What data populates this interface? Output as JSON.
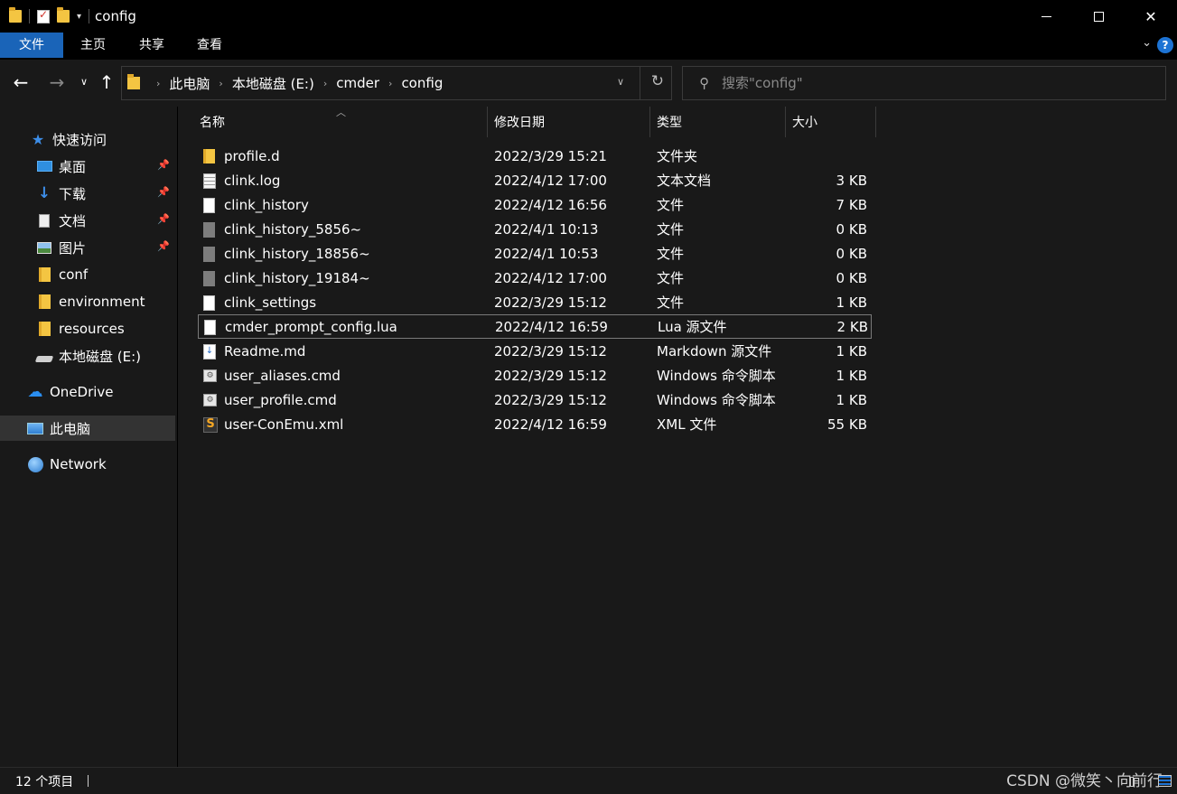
{
  "window": {
    "title": "config",
    "controls": {
      "minimize": "—",
      "maximize": "□",
      "close": "✕"
    }
  },
  "ribbon": {
    "tabs": [
      "文件",
      "主页",
      "共享",
      "查看"
    ],
    "expand_icon": "chevron-down-icon",
    "help_label": "?"
  },
  "nav": {
    "back": "←",
    "forward": "→",
    "recent": "⌄",
    "up": "↑",
    "breadcrumb": [
      "此电脑",
      "本地磁盘 (E:)",
      "cmder",
      "config"
    ],
    "refresh": "↻",
    "search_placeholder": "搜索\"config\""
  },
  "sidebar": {
    "items": [
      {
        "label": "快速访问",
        "icon": "star-icon",
        "pinned": false
      },
      {
        "label": "桌面",
        "icon": "desktop-icon",
        "pinned": true
      },
      {
        "label": "下载",
        "icon": "download-icon",
        "pinned": true
      },
      {
        "label": "文档",
        "icon": "document-icon",
        "pinned": true
      },
      {
        "label": "图片",
        "icon": "pictures-icon",
        "pinned": true
      },
      {
        "label": "conf",
        "icon": "folder-icon",
        "pinned": false
      },
      {
        "label": "environment",
        "icon": "folder-icon",
        "pinned": false
      },
      {
        "label": "resources",
        "icon": "folder-icon",
        "pinned": false
      },
      {
        "label": "本地磁盘 (E:)",
        "icon": "drive-icon",
        "pinned": false
      },
      {
        "label": "OneDrive",
        "icon": "cloud-icon",
        "pinned": false
      },
      {
        "label": "此电脑",
        "icon": "computer-icon",
        "pinned": false,
        "selected": true
      },
      {
        "label": "Network",
        "icon": "network-icon",
        "pinned": false
      }
    ]
  },
  "columns": {
    "name": "名称",
    "date": "修改日期",
    "type": "类型",
    "size": "大小"
  },
  "files": [
    {
      "name": "profile.d",
      "date": "2022/3/29 15:21",
      "type": "文件夹",
      "size": "",
      "icon": "folder-icon"
    },
    {
      "name": "clink.log",
      "date": "2022/4/12 17:00",
      "type": "文本文档",
      "size": "3 KB",
      "icon": "text-file-icon"
    },
    {
      "name": "clink_history",
      "date": "2022/4/12 16:56",
      "type": "文件",
      "size": "7 KB",
      "icon": "file-icon"
    },
    {
      "name": "clink_history_5856~",
      "date": "2022/4/1 10:13",
      "type": "文件",
      "size": "0 KB",
      "icon": "temp-file-icon"
    },
    {
      "name": "clink_history_18856~",
      "date": "2022/4/1 10:53",
      "type": "文件",
      "size": "0 KB",
      "icon": "temp-file-icon"
    },
    {
      "name": "clink_history_19184~",
      "date": "2022/4/12 17:00",
      "type": "文件",
      "size": "0 KB",
      "icon": "temp-file-icon"
    },
    {
      "name": "clink_settings",
      "date": "2022/3/29 15:12",
      "type": "文件",
      "size": "1 KB",
      "icon": "file-icon"
    },
    {
      "name": "cmder_prompt_config.lua",
      "date": "2022/4/12 16:59",
      "type": "Lua 源文件",
      "size": "2 KB",
      "icon": "lua-file-icon",
      "focused": true
    },
    {
      "name": "Readme.md",
      "date": "2022/3/29 15:12",
      "type": "Markdown 源文件",
      "size": "1 KB",
      "icon": "markdown-file-icon"
    },
    {
      "name": "user_aliases.cmd",
      "date": "2022/3/29 15:12",
      "type": "Windows 命令脚本",
      "size": "1 KB",
      "icon": "cmd-file-icon"
    },
    {
      "name": "user_profile.cmd",
      "date": "2022/3/29 15:12",
      "type": "Windows 命令脚本",
      "size": "1 KB",
      "icon": "cmd-file-icon"
    },
    {
      "name": "user-ConEmu.xml",
      "date": "2022/4/12 16:59",
      "type": "XML 文件",
      "size": "55 KB",
      "icon": "xml-file-icon"
    }
  ],
  "status": {
    "count": "12 个项目",
    "watermark": "CSDN @微笑丶向前行"
  },
  "colors": {
    "accent": "#1a64b8",
    "background": "#191919",
    "selected": "#333333"
  }
}
